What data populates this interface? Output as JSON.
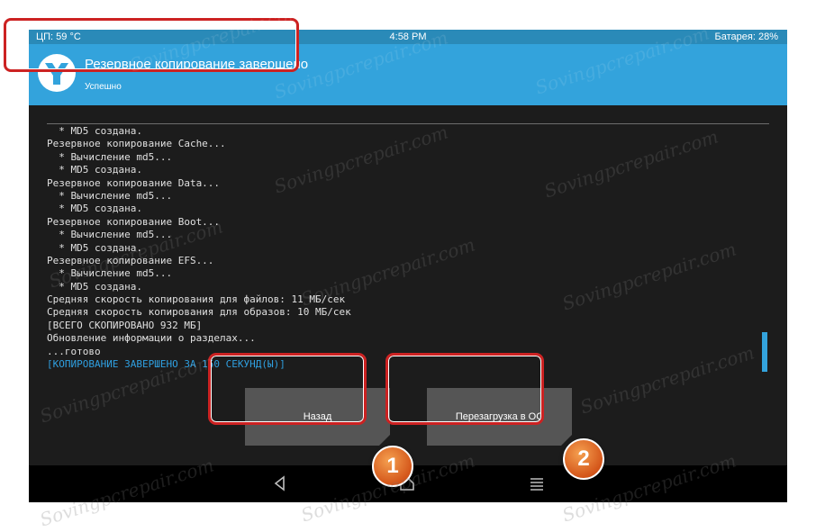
{
  "statusbar": {
    "cpu": "ЦП: 59 °C",
    "time": "4:58 PM",
    "battery": "Батарея: 28%"
  },
  "header": {
    "title": "Резервное копирование завершено",
    "subtitle": "Успешно",
    "logo_icon": "twrp-logo-icon"
  },
  "console": {
    "lines": [
      "  * MD5 создана.",
      "Резервное копирование Cache...",
      "  * Вычисление md5...",
      "  * MD5 создана.",
      "Резервное копирование Data...",
      "  * Вычисление md5...",
      "  * MD5 создана.",
      "Резервное копирование Boot...",
      "  * Вычисление md5...",
      "  * MD5 создана.",
      "Резервное копирование EFS...",
      "  * Вычисление md5...",
      "  * MD5 создана.",
      "Средняя скорость копирования для файлов: 11 МБ/сек",
      "Средняя скорость копирования для образов: 10 МБ/сек",
      "[ВСЕГО СКОПИРОВАНО 932 МБ]",
      "Обновление информации о разделах...",
      "...готово",
      "[КОПИРОВАНИЕ ЗАВЕРШЕНО ЗА 150 СЕКУНД(Ы)]"
    ]
  },
  "buttons": {
    "back": "Назад",
    "reboot": "Перезагрузка в ОС"
  },
  "markers": {
    "one": "1",
    "two": "2"
  },
  "navbar": {
    "back_icon": "back-triangle-icon",
    "home_icon": "home-icon",
    "menu_icon": "menu-icon"
  },
  "watermark": "Sovingpcrepair.com",
  "colors": {
    "header": "#33a3dc",
    "statusbar": "#2a8ab8",
    "highlight": "#cc2222",
    "marker": "#e06a24",
    "console_final": "#2f9fe0"
  }
}
